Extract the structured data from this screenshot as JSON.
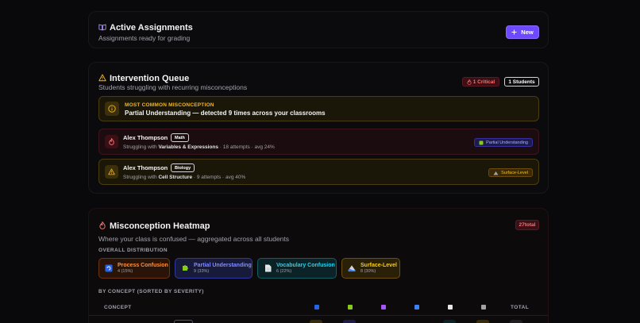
{
  "assignments": {
    "title": "Active Assignments",
    "subtitle": "Assignments ready for grading",
    "new_button": "New",
    "icon": "book-open-icon"
  },
  "queue": {
    "title": "Intervention Queue",
    "subtitle": "Students struggling with recurring misconceptions",
    "critical_badge": "1 Critical",
    "students_badge": "1 Students",
    "banner": {
      "label": "MOST COMMON MISCONCEPTION",
      "text": "Partial Understanding — detected 9 times across your classrooms"
    },
    "students": [
      {
        "name": "Alex Thompson",
        "subject": "Math",
        "prefix": "Struggling with",
        "topic": "Variables & Expressions",
        "stats": "· 18 attempts · avg 24%",
        "tag": "Partial Understanding",
        "severity": "critical"
      },
      {
        "name": "Alex Thompson",
        "subject": "Biology",
        "prefix": "Struggling with",
        "topic": "Cell Structure",
        "stats": "· 9 attempts · avg 40%",
        "tag": "Surface-Level",
        "severity": "warning"
      }
    ]
  },
  "heatmap": {
    "title": "Misconception Heatmap",
    "subtitle": "Where your class is confused — aggregated across all students",
    "total_badge": "27total",
    "overall_label": "OVERALL DISTRIBUTION",
    "distribution": [
      {
        "name": "Process Confusion",
        "count": "4 (15%)",
        "color": "#fb923c"
      },
      {
        "name": "Partial Understanding",
        "count": "9 (33%)",
        "color": "#818cf8"
      },
      {
        "name": "Vocabulary Confusion",
        "count": "6 (22%)",
        "color": "#22d3ee"
      },
      {
        "name": "Surface-Level",
        "count": "8 (30%)",
        "color": "#facc15"
      }
    ],
    "by_concept_label": "BY CONCEPT (SORTED BY SEVERITY)",
    "columns": {
      "concept": "CONCEPT",
      "total": "TOTAL"
    }
  }
}
